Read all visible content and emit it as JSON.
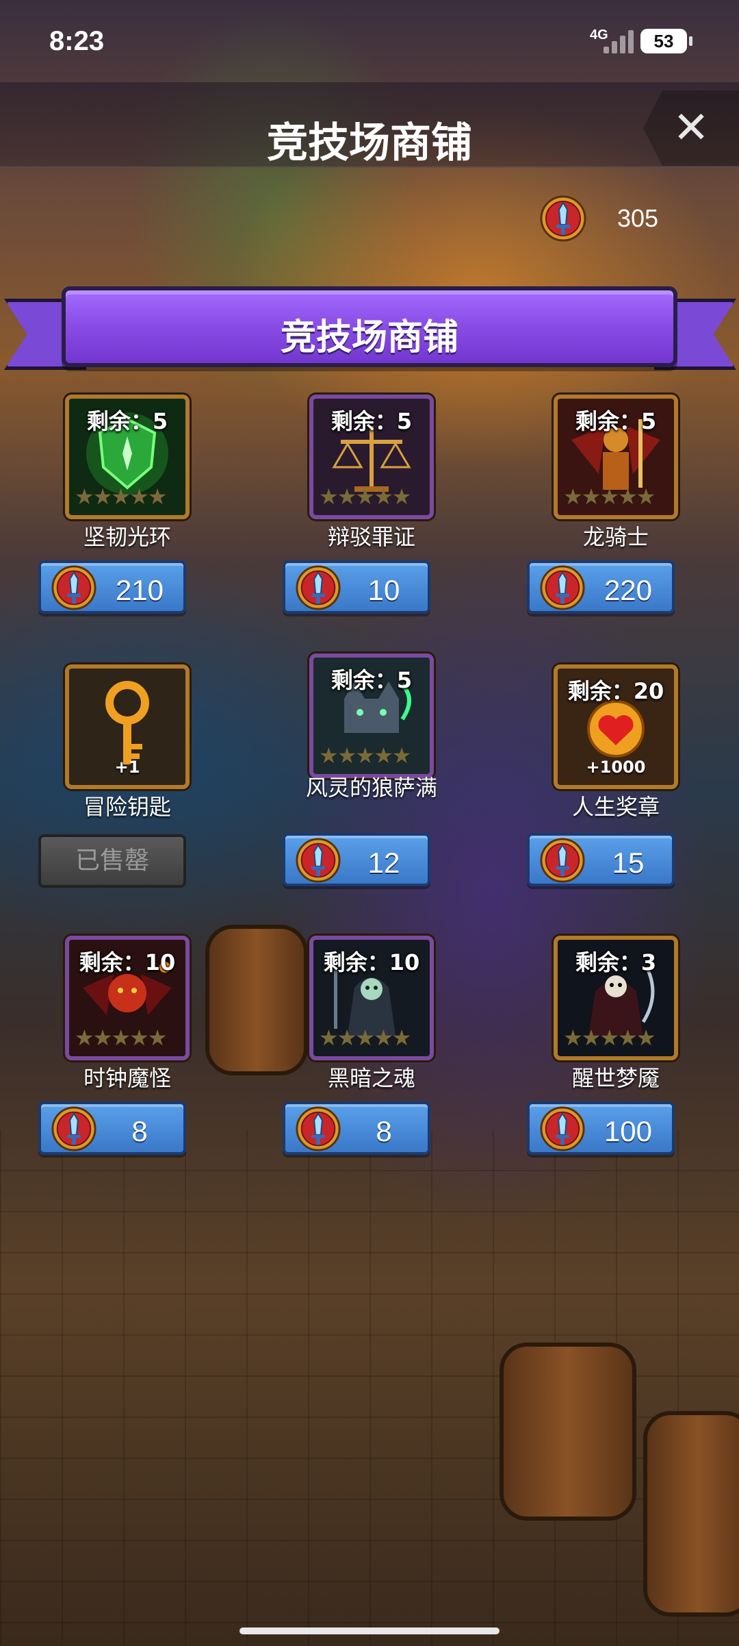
{
  "status_bar": {
    "time": "8:23",
    "network": "4G",
    "battery": "53"
  },
  "header": {
    "title": "竞技场商铺",
    "close_label": "✕"
  },
  "balance": {
    "currency_icon": "sword-coin-icon",
    "value": "305"
  },
  "banner": {
    "title": "竞技场商铺"
  },
  "colors": {
    "banner": "#8b4fe8",
    "price_button": "#4a8ad8",
    "sold_button": "#4a4a4a"
  },
  "items": [
    {
      "name": "坚韧光环",
      "remain": "剩余：5",
      "price": "210",
      "stars": "★★★★★",
      "art": "shield-aura-icon",
      "frame": "brown",
      "sold": false
    },
    {
      "name": "辩驳罪证",
      "remain": "剩余：5",
      "price": "10",
      "stars": "★★★★★",
      "art": "scales-icon",
      "frame": "purple",
      "sold": false
    },
    {
      "name": "龙骑士",
      "remain": "剩余：5",
      "price": "220",
      "stars": "★★★★★",
      "art": "dragon-knight-icon",
      "frame": "brown",
      "sold": false
    },
    {
      "name": "冒险钥匙",
      "remain": "",
      "qty": "+1",
      "art": "key-icon",
      "frame": "brown",
      "sold": true,
      "sold_label": "已售罄"
    },
    {
      "name": "风灵的狼萨满",
      "remain": "剩余：5",
      "price": "12",
      "stars": "★★★★★",
      "art": "wolf-shaman-icon",
      "frame": "purple",
      "sold": false
    },
    {
      "name": "人生奖章",
      "remain": "剩余：20",
      "qty": "+1000",
      "price": "15",
      "art": "heart-medal-icon",
      "frame": "brown",
      "sold": false
    },
    {
      "name": "时钟魔怪",
      "remain": "剩余：10",
      "price": "8",
      "stars": "★★★★★",
      "art": "clock-demon-icon",
      "frame": "purple",
      "sold": false
    },
    {
      "name": "黑暗之魂",
      "remain": "剩余：10",
      "price": "8",
      "stars": "★★★★★",
      "art": "dark-soul-icon",
      "frame": "purple",
      "sold": false
    },
    {
      "name": "醒世梦魇",
      "remain": "剩余：3",
      "price": "100",
      "stars": "★★★★★",
      "art": "nightmare-icon",
      "frame": "brown",
      "sold": false
    }
  ]
}
